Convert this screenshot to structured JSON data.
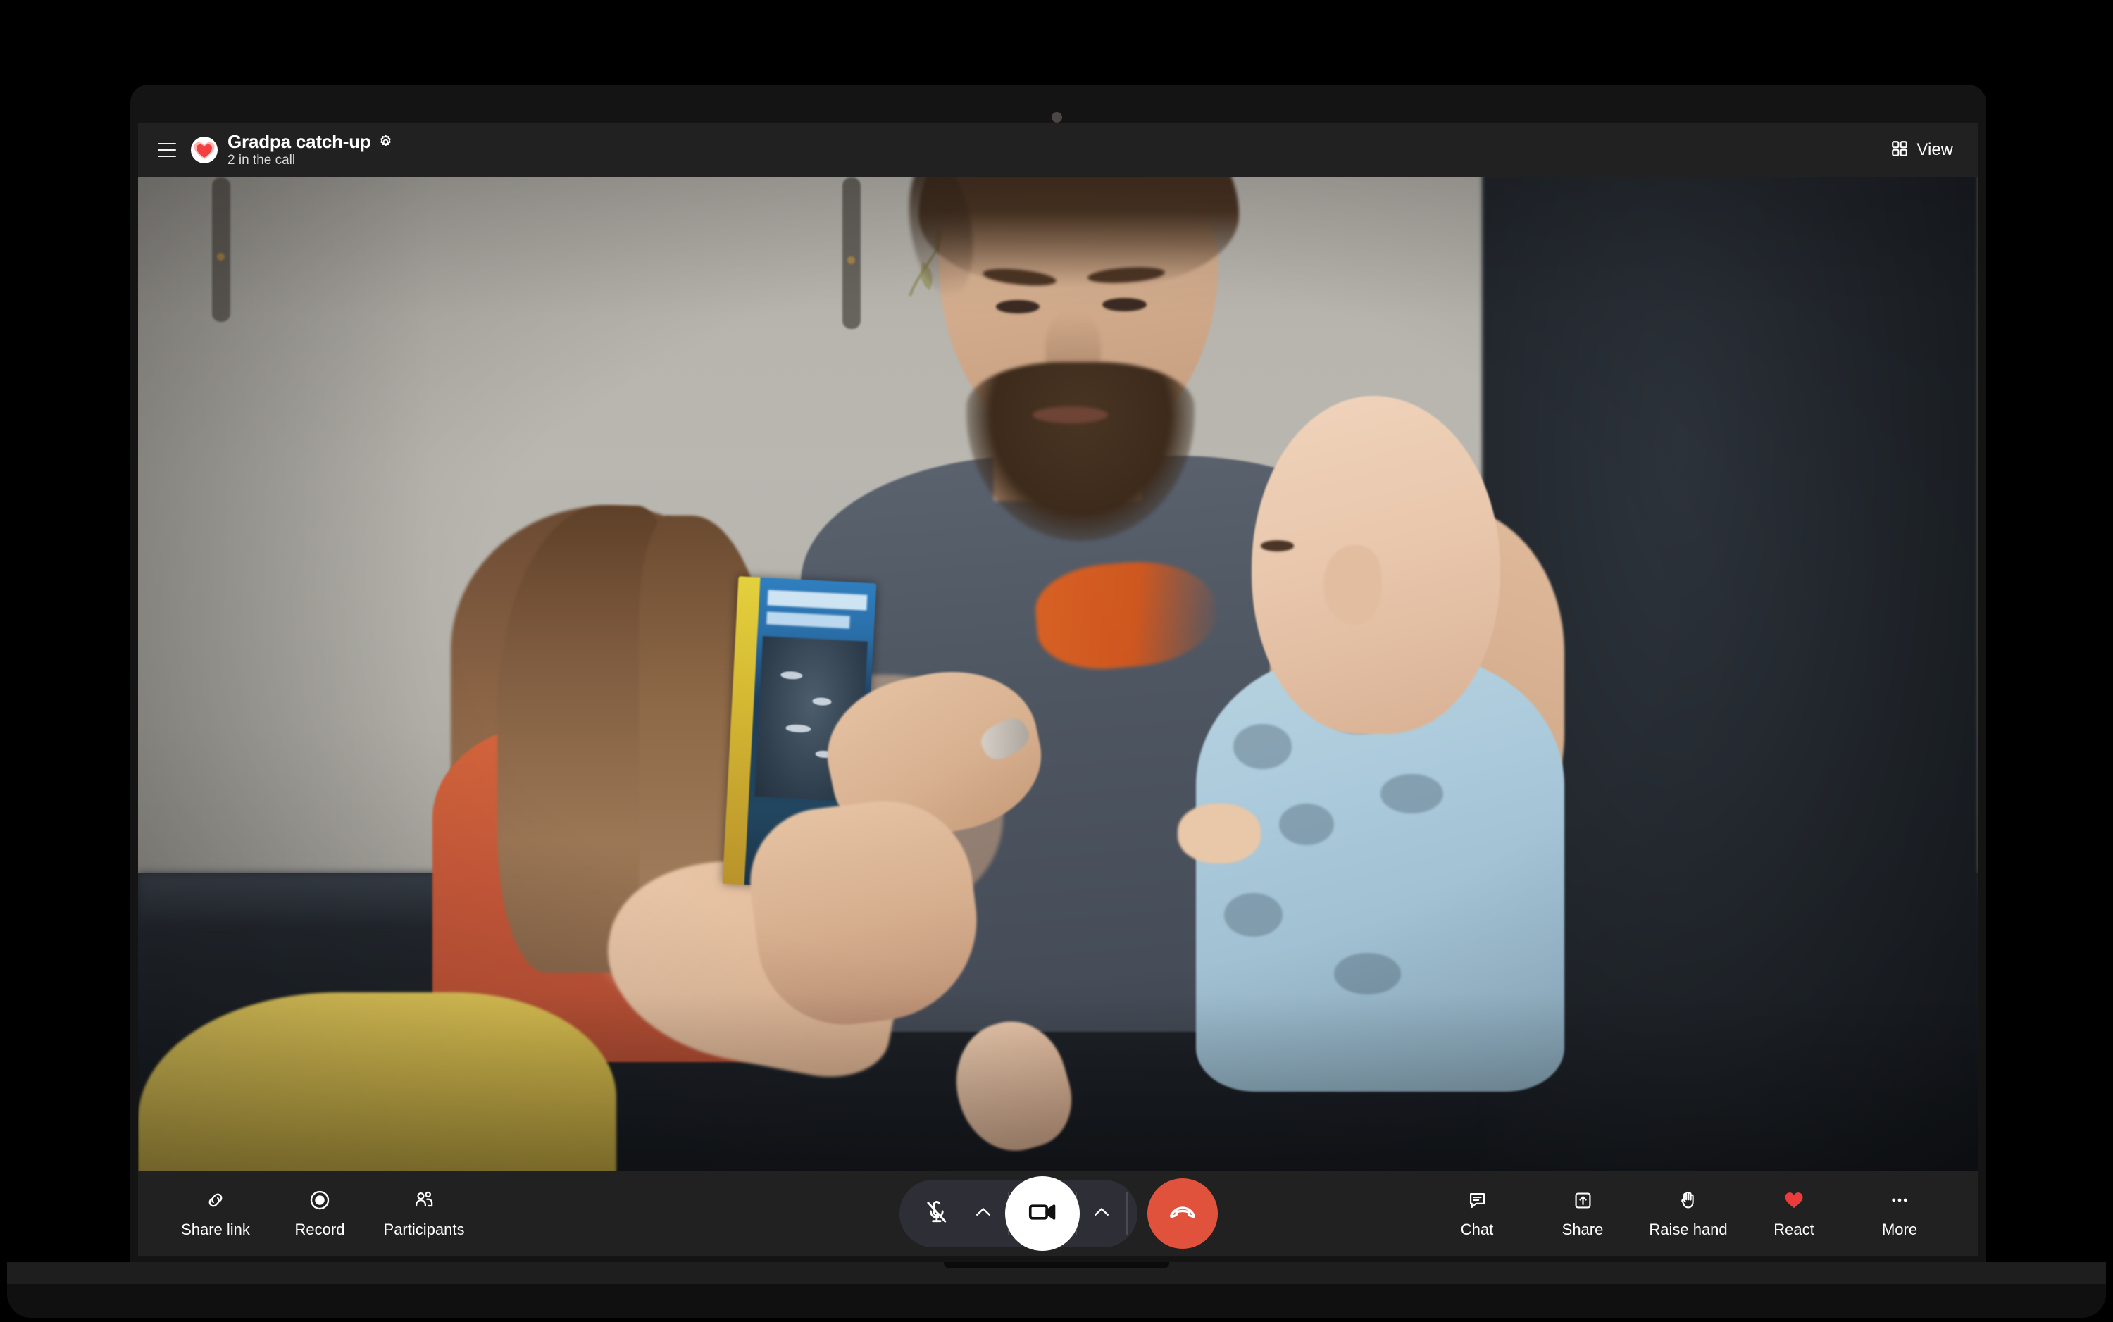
{
  "window": {
    "device": "laptop",
    "webcam": "webcam-dot"
  },
  "header": {
    "menu_icon": "hamburger-menu-icon",
    "logo_icon": "heart-logo-icon",
    "meeting_title": "Gradpa catch-up",
    "settings_icon": "gear-icon",
    "participants_status": "2 in the call",
    "view_button": {
      "label": "View",
      "icon": "grid-view-icon"
    }
  },
  "video": {
    "alt": "Man holding a baby and sitting beside a young girl on a dark couch, reading a blue picture book",
    "colors": {
      "wall": "#b7b4ad",
      "couch": "#242931",
      "girl_shirt": "#c8583a",
      "baby_onesie": "#a8c8da",
      "book_cover": "#2a6ea8",
      "yellow_cushion": "#e0c553"
    }
  },
  "toolbar": {
    "left": [
      {
        "label": "Share link",
        "icon": "link-icon"
      },
      {
        "label": "Record",
        "icon": "record-icon"
      },
      {
        "label": "Participants",
        "icon": "people-icon"
      }
    ],
    "center": {
      "mic": {
        "name": "microphone-muted",
        "icon": "mic-off-icon",
        "muted": true
      },
      "mic_options": {
        "icon": "chevron-up-icon"
      },
      "camera": {
        "name": "camera-on",
        "icon": "video-camera-icon",
        "active": true
      },
      "camera_options": {
        "icon": "chevron-up-icon"
      },
      "hangup": {
        "name": "end-call",
        "icon": "phone-hangup-icon",
        "color": "#e0523c"
      }
    },
    "right": [
      {
        "label": "Chat",
        "icon": "chat-bubble-icon"
      },
      {
        "label": "Share",
        "icon": "share-upload-icon"
      },
      {
        "label": "Raise hand",
        "icon": "raised-hand-icon"
      },
      {
        "label": "React",
        "icon": "heart-icon",
        "color": "#ec3b3b"
      },
      {
        "label": "More",
        "icon": "ellipsis-icon"
      }
    ]
  }
}
